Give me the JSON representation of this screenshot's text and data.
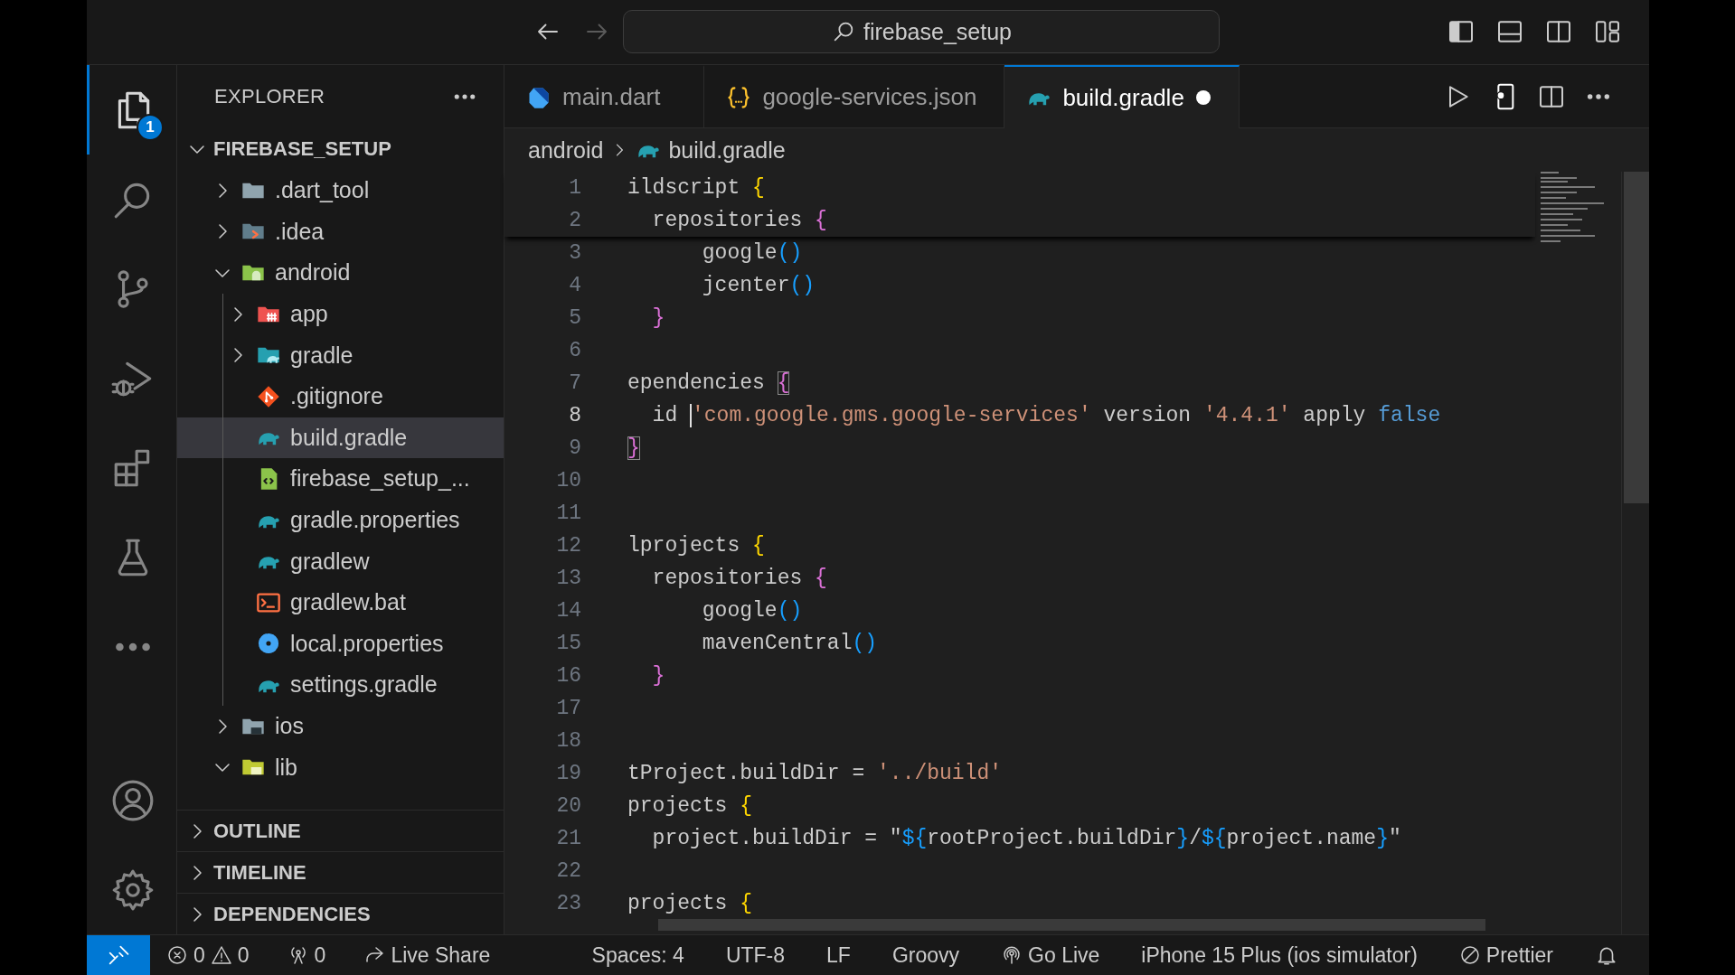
{
  "title_bar": {
    "nav": [
      {
        "kind": "back",
        "disabled": false
      },
      {
        "kind": "forward",
        "disabled": true
      }
    ],
    "search": "firebase_setup",
    "layout": [
      {
        "kind": "primary-sidebar",
        "on": true
      },
      {
        "kind": "panel",
        "on": false
      },
      {
        "kind": "secondary-sidebar",
        "on": false
      },
      {
        "kind": "customize"
      }
    ]
  },
  "activity_bar": {
    "items": [
      {
        "kind": "explorer",
        "selected": true,
        "badge": "1"
      },
      {
        "kind": "search",
        "selected": false
      },
      {
        "kind": "source-control",
        "selected": false
      },
      {
        "kind": "run-debug",
        "selected": false
      },
      {
        "kind": "extensions",
        "selected": false
      },
      {
        "kind": "testing",
        "selected": false
      },
      {
        "kind": "more",
        "selected": false
      }
    ],
    "bottom": [
      {
        "kind": "accounts"
      },
      {
        "kind": "manage"
      }
    ]
  },
  "sidebar": {
    "title": "EXPLORER",
    "root": {
      "label": "FIREBASE_SETUP",
      "expanded": true,
      "children": [
        {
          "label": ".dart_tool",
          "kind": "folder",
          "expanded": false,
          "selected": false
        },
        {
          "label": ".idea",
          "kind": "idea",
          "expanded": false,
          "selected": false
        },
        {
          "label": "android",
          "kind": "android",
          "expanded": true,
          "selected": false,
          "children": [
            {
              "label": "app",
              "kind": "app",
              "expanded": false,
              "selected": false
            },
            {
              "label": "gradle",
              "kind": "gradle-folder",
              "expanded": false,
              "selected": false
            },
            {
              "label": ".gitignore",
              "kind": "git",
              "selected": false
            },
            {
              "label": "build.gradle",
              "kind": "gradle",
              "selected": true
            },
            {
              "label": "firebase_setup_...",
              "kind": "xml",
              "selected": false
            },
            {
              "label": "gradle.properties",
              "kind": "gradle",
              "selected": false
            },
            {
              "label": "gradlew",
              "kind": "gradle",
              "selected": false
            },
            {
              "label": "gradlew.bat",
              "kind": "terminal",
              "selected": false
            },
            {
              "label": "local.properties",
              "kind": "settings",
              "selected": false
            },
            {
              "label": "settings.gradle",
              "kind": "gradle",
              "selected": false
            }
          ]
        },
        {
          "label": "ios",
          "kind": "ios",
          "expanded": false,
          "selected": false
        },
        {
          "label": "lib",
          "kind": "lib",
          "expanded": true,
          "selected": false
        }
      ]
    },
    "sections": [
      {
        "label": "OUTLINE",
        "expanded": false
      },
      {
        "label": "TIMELINE",
        "expanded": false
      },
      {
        "label": "DEPENDENCIES",
        "expanded": false
      }
    ]
  },
  "tabs": [
    {
      "label": "main.dart",
      "kind": "dart",
      "selected": false,
      "modified": false
    },
    {
      "label": "google-services.json",
      "kind": "json",
      "selected": false,
      "modified": false
    },
    {
      "label": "build.gradle",
      "kind": "gradle",
      "selected": true,
      "modified": true
    }
  ],
  "breadcrumb": [
    {
      "label": "android",
      "kind": "folder"
    },
    {
      "label": "build.gradle",
      "kind": "gradle"
    }
  ],
  "code": {
    "sticky_lines": [
      {
        "number": "1",
        "current": false,
        "tokens": [
          {
            "text": "ildscript ",
            "kind": "plain"
          },
          {
            "text": "{",
            "kind": "brace-1"
          }
        ]
      },
      {
        "number": "2",
        "current": false,
        "tokens": [
          {
            "text": "  repositories ",
            "kind": "plain"
          },
          {
            "text": "{",
            "kind": "brace-2"
          }
        ]
      }
    ],
    "lines": [
      {
        "number": "3",
        "current": false,
        "tokens": [
          {
            "text": "      google",
            "kind": "plain"
          },
          {
            "text": "()",
            "kind": "paren"
          }
        ]
      },
      {
        "number": "4",
        "current": false,
        "tokens": [
          {
            "text": "      jcenter",
            "kind": "plain"
          },
          {
            "text": "()",
            "kind": "paren"
          }
        ]
      },
      {
        "number": "5",
        "current": false,
        "tokens": [
          {
            "text": "  }",
            "kind": "brace-2"
          }
        ]
      },
      {
        "number": "6",
        "current": false
      },
      {
        "number": "7",
        "current": false,
        "tokens": [
          {
            "text": "ependencies ",
            "kind": "plain"
          },
          {
            "text": "{",
            "kind": "brace-2",
            "matched": true
          }
        ]
      },
      {
        "number": "8",
        "current": true,
        "tokens": [
          {
            "text": "  id ",
            "kind": "plain"
          },
          {
            "text": "'com.google.gms.google-services'",
            "kind": "string",
            "cursor": true
          },
          {
            "text": " version ",
            "kind": "plain"
          },
          {
            "text": "'4.4.1'",
            "kind": "string"
          },
          {
            "text": " apply ",
            "kind": "plain"
          },
          {
            "text": "false",
            "kind": "keyword"
          }
        ]
      },
      {
        "number": "9",
        "current": false,
        "tokens": [
          {
            "text": "}",
            "kind": "brace-2",
            "matched": true
          }
        ]
      },
      {
        "number": "10",
        "current": false
      },
      {
        "number": "11",
        "current": false
      },
      {
        "number": "12",
        "current": false,
        "tokens": [
          {
            "text": "lprojects ",
            "kind": "plain"
          },
          {
            "text": "{",
            "kind": "brace-1"
          }
        ]
      },
      {
        "number": "13",
        "current": false,
        "tokens": [
          {
            "text": "  repositories ",
            "kind": "plain"
          },
          {
            "text": "{",
            "kind": "brace-2"
          }
        ]
      },
      {
        "number": "14",
        "current": false,
        "tokens": [
          {
            "text": "      google",
            "kind": "plain"
          },
          {
            "text": "()",
            "kind": "paren"
          }
        ]
      },
      {
        "number": "15",
        "current": false,
        "tokens": [
          {
            "text": "      mavenCentral",
            "kind": "plain"
          },
          {
            "text": "()",
            "kind": "paren"
          }
        ]
      },
      {
        "number": "16",
        "current": false,
        "tokens": [
          {
            "text": "  }",
            "kind": "brace-2"
          }
        ]
      },
      {
        "number": "17",
        "current": false
      },
      {
        "number": "18",
        "current": false
      },
      {
        "number": "19",
        "current": false,
        "tokens": [
          {
            "text": "tProject.buildDir = ",
            "kind": "plain"
          },
          {
            "text": "'../build'",
            "kind": "string"
          }
        ]
      },
      {
        "number": "20",
        "current": false,
        "tokens": [
          {
            "text": "projects ",
            "kind": "plain"
          },
          {
            "text": "{",
            "kind": "brace-1"
          }
        ]
      },
      {
        "number": "21",
        "current": false,
        "tokens": [
          {
            "text": "  project.buildDir = \"",
            "kind": "plain"
          },
          {
            "text": "${",
            "kind": "paren"
          },
          {
            "text": "rootProject.buildDir",
            "kind": "plain"
          },
          {
            "text": "}",
            "kind": "paren"
          },
          {
            "text": "/",
            "kind": "plain"
          },
          {
            "text": "${",
            "kind": "paren"
          },
          {
            "text": "project.name",
            "kind": "plain"
          },
          {
            "text": "}",
            "kind": "paren"
          },
          {
            "text": "\"",
            "kind": "plain"
          }
        ]
      },
      {
        "number": "22",
        "current": false
      },
      {
        "number": "23",
        "current": false,
        "tokens": [
          {
            "text": "projects ",
            "kind": "plain"
          },
          {
            "text": "{",
            "kind": "brace-1"
          }
        ]
      }
    ]
  },
  "status_bar": {
    "left": [
      {
        "kind": "remote"
      },
      {
        "kind": "problems",
        "errors": "0",
        "warnings": "0"
      },
      {
        "kind": "ports",
        "text": "0"
      },
      {
        "kind": "live-share",
        "text": "Live Share"
      }
    ],
    "right": [
      {
        "kind": "plain",
        "text": "Spaces: 4"
      },
      {
        "kind": "plain",
        "text": "UTF-8"
      },
      {
        "kind": "plain",
        "text": "LF"
      },
      {
        "kind": "plain",
        "text": "Groovy"
      },
      {
        "kind": "go-live",
        "text": "Go Live"
      },
      {
        "kind": "plain",
        "text": "iPhone 15 Plus (ios simulator)"
      },
      {
        "kind": "prettier",
        "text": "Prettier"
      },
      {
        "kind": "bell"
      }
    ]
  }
}
